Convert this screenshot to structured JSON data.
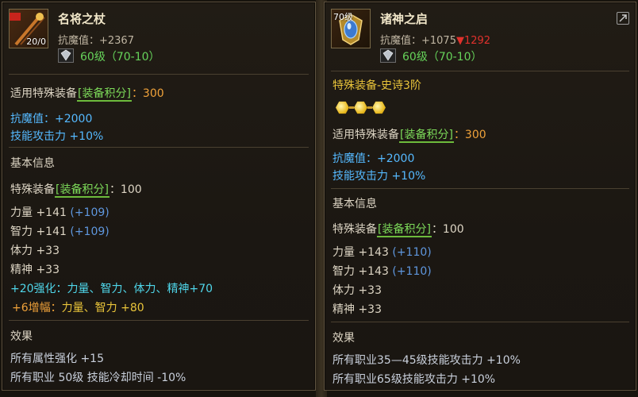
{
  "left": {
    "level_badge": "20/0",
    "name": "名将之杖",
    "magic_defense": "抗魔值：+2367",
    "level_line": "60级（70-10）",
    "score_prefix": "适用特殊装备",
    "score_badge": "[装备积分]",
    "score_value": "：300",
    "magic_stat": "抗魔值：+2000",
    "skill_attack": "技能攻击力 +10%",
    "basic_title": "基本信息",
    "basic_prefix": "特殊装备",
    "basic_badge": "[装备积分]",
    "basic_value": "：100",
    "stats": [
      {
        "label": "力量 +141 ",
        "bonus": "(+109)"
      },
      {
        "label": "智力 +141 ",
        "bonus": "(+109)"
      },
      {
        "label": "体力 +33",
        "bonus": ""
      },
      {
        "label": "精神 +33",
        "bonus": ""
      }
    ],
    "enhance": "+20强化：力量、智力、体力、精神+70",
    "amplify_prefix": "+6增幅：",
    "amplify_value": "力量、智力 +80",
    "effect_title": "效果",
    "effects": [
      "所有属性强化 +15",
      "所有职业 50级 技能冷却时间 -10%"
    ]
  },
  "right": {
    "level_badge": "70级",
    "name": "诸神之启",
    "magic_defense": "抗魔值：+1075",
    "magic_diff": "▼1292",
    "level_line": "60级（70-10）",
    "tier": "特殊装备-史诗3阶",
    "score_prefix": "适用特殊装备",
    "score_badge": "[装备积分]",
    "score_value": "：300",
    "magic_stat": "抗魔值：+2000",
    "skill_attack": "技能攻击力 +10%",
    "basic_title": "基本信息",
    "basic_prefix": "特殊装备",
    "basic_badge": "[装备积分]",
    "basic_value": "：100",
    "stats": [
      {
        "label": "力量 +143 ",
        "bonus": "(+110)"
      },
      {
        "label": "智力 +143 ",
        "bonus": "(+110)"
      },
      {
        "label": "体力 +33",
        "bonus": ""
      },
      {
        "label": "精神 +33",
        "bonus": ""
      }
    ],
    "effect_title": "效果",
    "effects": [
      "所有职业35—45级技能攻击力 +10%",
      "所有职业65级技能攻击力 +10%"
    ]
  },
  "colors": {
    "accent_gold": "#e9c43a",
    "stat_blue": "#55b9ff",
    "green": "#7ddb5a"
  },
  "icons": [
    "staff-icon",
    "shield-gem-icon",
    "gem-icon",
    "star-hex-icon",
    "compare-icon"
  ]
}
